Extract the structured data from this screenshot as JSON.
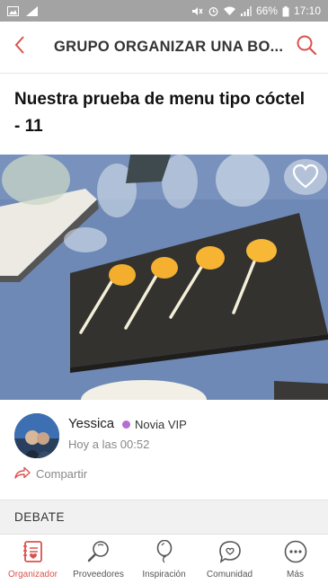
{
  "statusbar": {
    "battery": "66%",
    "time": "17:10"
  },
  "appbar": {
    "title": "GRUPO ORGANIZAR UNA BO..."
  },
  "post": {
    "title": "Nuestra prueba de menu tipo cóctel - 11",
    "author": "Yessica",
    "badge": "Novia VIP",
    "time": "Hoy a las 00:52",
    "share_label": "Compartir"
  },
  "section": {
    "debate_label": "DEBATE"
  },
  "bottom_nav": {
    "items": [
      {
        "label": "Organizador",
        "icon": "planner-icon",
        "active": true
      },
      {
        "label": "Proveedores",
        "icon": "search-icon",
        "active": false
      },
      {
        "label": "Inspiración",
        "icon": "balloon-icon",
        "active": false
      },
      {
        "label": "Comunidad",
        "icon": "chat-heart-icon",
        "active": false
      },
      {
        "label": "Más",
        "icon": "more-icon",
        "active": false
      }
    ]
  },
  "colors": {
    "accent": "#d9534f",
    "statusbar": "#a3a3a3",
    "vip_dot": "#b36fd1"
  }
}
